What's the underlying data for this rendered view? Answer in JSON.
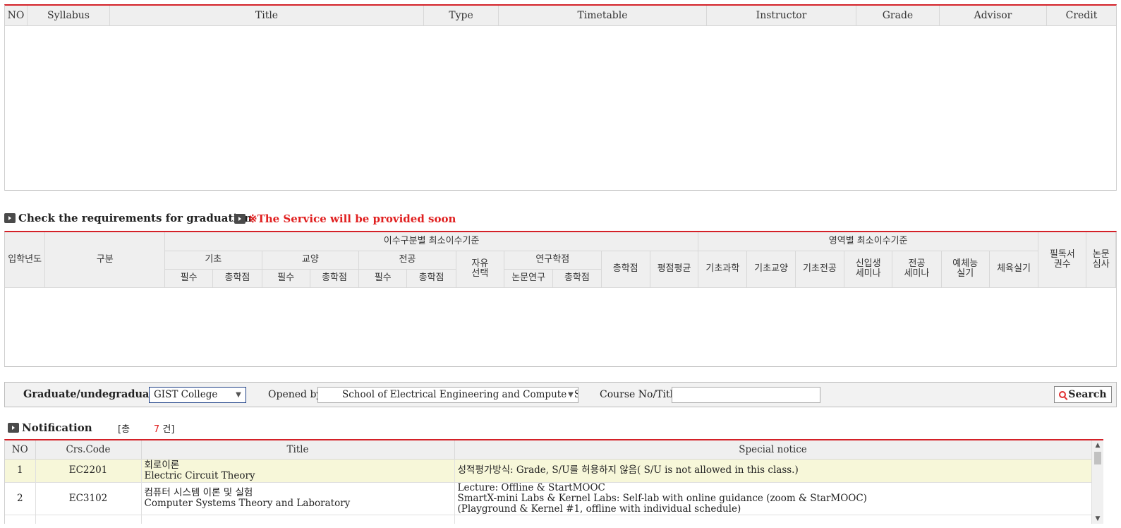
{
  "course_table": {
    "headers": [
      "NO",
      "Syllabus",
      "Title",
      "Type",
      "Timetable",
      "Instructor",
      "Grade",
      "Advisor",
      "Credit"
    ]
  },
  "graduation": {
    "title": "Check the requirements for graduation",
    "notice": "※The Service will be provided soon",
    "headers": {
      "admission_year": "입학년도",
      "category": "구분",
      "min_by_type": "이수구분별 최소이수기준",
      "min_by_area": "영역별 최소이수기준",
      "basic": "기초",
      "liberal": "교양",
      "major": "전공",
      "free_elective": "자유\n선택",
      "research": "연구학점",
      "required": "필수",
      "total_credits": "총학점",
      "thesis_research": "논문연구",
      "total": "총학점",
      "gpa": "평점평균",
      "basic_science": "기초과학",
      "basic_liberal": "기초교양",
      "basic_major": "기초전공",
      "freshman_seminar": "신입생\n세미나",
      "major_seminar": "전공\n세미나",
      "arts_sports": "예체능\n실기",
      "physical_ed": "체육실기",
      "required_reading": "필독서\n권수",
      "thesis_exam": "논문\n심사"
    }
  },
  "search": {
    "grad_label": "Graduate/undegraduate",
    "required_mark": "*",
    "grad_value": "GIST College",
    "opened_label": "Opened by",
    "opened_value": "School of Electrical Engineering and Computer Science",
    "course_label": "Course No/Title",
    "course_value": "",
    "button": "Search"
  },
  "notification": {
    "title": "Notification",
    "count_prefix": "[총",
    "count": "7",
    "count_suffix": "건]",
    "headers": [
      "NO",
      "Crs.Code",
      "Title",
      "Special notice"
    ],
    "rows": [
      {
        "no": "1",
        "code": "EC2201",
        "title_kr": "회로이론",
        "title_en": "Electric Circuit Theory",
        "notice": [
          "성적평가방식: Grade, S/U를 허용하지 않음( S/U is not allowed in this class.)"
        ]
      },
      {
        "no": "2",
        "code": "EC3102",
        "title_kr": "컴퓨터 시스템 이론 및 실험",
        "title_en": "Computer Systems Theory and Laboratory",
        "notice": [
          "Lecture: Offline & StartMOOC",
          "SmartX-mini Labs & Kernel Labs: Self-lab with online guidance (zoom & StarMOOC)",
          "(Playground & Kernel #1, offline with individual schedule)"
        ]
      }
    ]
  }
}
